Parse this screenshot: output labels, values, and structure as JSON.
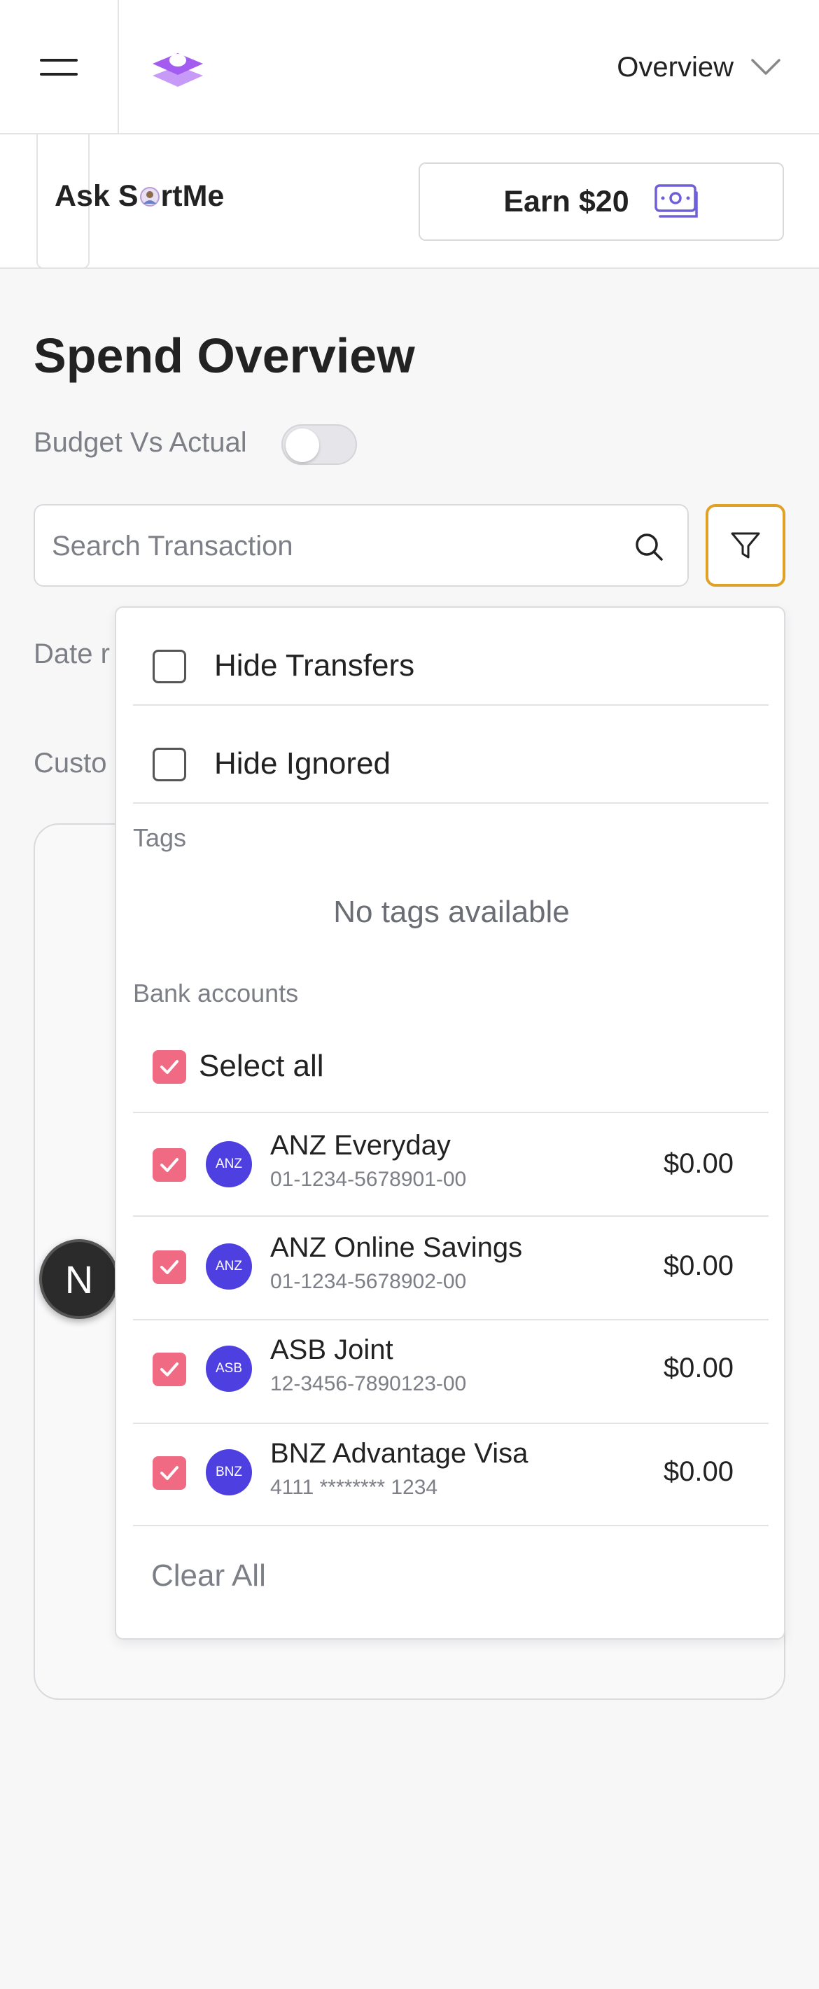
{
  "header": {
    "nav_select_label": "Overview"
  },
  "assistant": {
    "label_prefix": "Ask S",
    "label_suffix": "rtMe"
  },
  "promo": {
    "earn_label": "Earn $20"
  },
  "page": {
    "title": "Spend Overview",
    "budget_toggle_label": "Budget Vs Actual",
    "budget_toggle_on": false
  },
  "search": {
    "placeholder": "Search Transaction"
  },
  "behind": {
    "date_label_partial": "Date r",
    "custom_label_partial": "Custo"
  },
  "filter_menu": {
    "hide_transfers_label": "Hide Transfers",
    "hide_transfers_checked": false,
    "hide_ignored_label": "Hide Ignored",
    "hide_ignored_checked": false,
    "tags_section_label": "Tags",
    "no_tags_text": "No tags available",
    "bank_section_label": "Bank accounts",
    "select_all_label": "Select all",
    "accounts": [
      {
        "avatar": "ANZ",
        "name": "ANZ Everyday",
        "number": "01-1234-5678901-00",
        "balance": "$0.00",
        "checked": true
      },
      {
        "avatar": "ANZ",
        "name": "ANZ Online Savings",
        "number": "01-1234-5678902-00",
        "balance": "$0.00",
        "checked": true
      },
      {
        "avatar": "ASB",
        "name": "ASB Joint",
        "number": "12-3456-7890123-00",
        "balance": "$0.00",
        "checked": true
      },
      {
        "avatar": "BNZ",
        "name": "BNZ Advantage Visa",
        "number": "4111 ******** 1234",
        "balance": "$0.00",
        "checked": true
      }
    ],
    "clear_all_label": "Clear All"
  },
  "dev_badge": {
    "letter": "N"
  },
  "colors": {
    "checkbox_checked": "#f06a84",
    "filter_active_border": "#e0a126",
    "bank_avatar": "#4d3fe0",
    "logo_purple": "#a35bf0"
  },
  "icons": {
    "menu": "hamburger-icon",
    "logo": "stack-logo-icon",
    "select": "chevron-down-icon",
    "promo": "cash-icon",
    "search": "search-icon",
    "filter": "filter-icon",
    "check": "check-icon"
  }
}
